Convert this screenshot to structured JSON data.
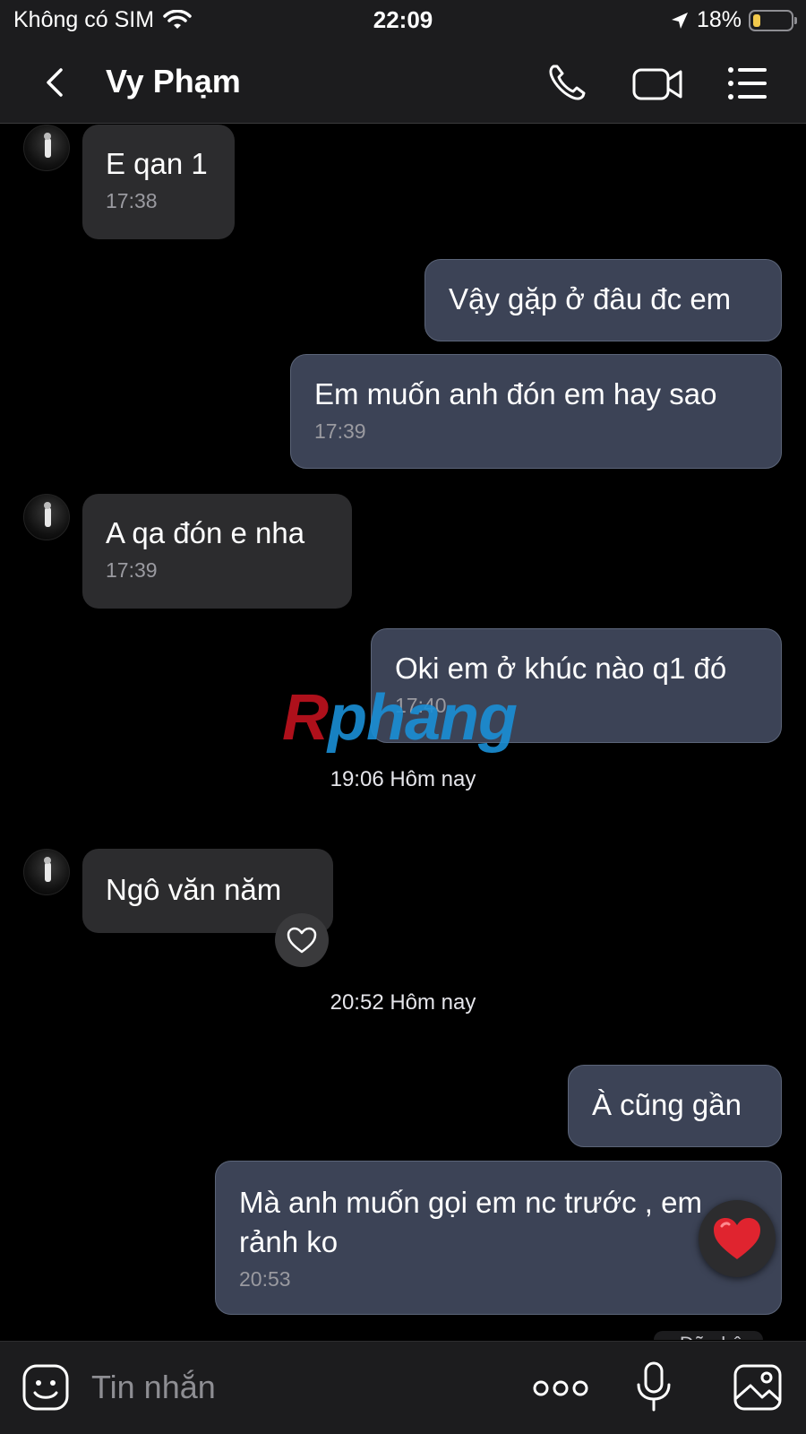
{
  "status_bar": {
    "carrier": "Không có SIM",
    "time": "22:09",
    "battery_percent": "18%",
    "battery_level": 0.18,
    "battery_color": "#f2c94c"
  },
  "header": {
    "contact_name": "Vy Phạm",
    "icons": [
      "back-icon",
      "phone-icon",
      "video-camera-icon",
      "menu-list-icon"
    ]
  },
  "messages": [
    {
      "side": "in",
      "text": "E qan 1",
      "time": "17:38"
    },
    {
      "side": "out",
      "text": "Vậy gặp ở đâu đc em"
    },
    {
      "side": "out",
      "text": "Em muốn anh đón em hay sao",
      "time": "17:39"
    },
    {
      "side": "in",
      "text": "A qa đón e nha",
      "time": "17:39"
    },
    {
      "side": "out",
      "text": "Oki em ở khúc nào q1 đó",
      "time": "17:40"
    },
    {
      "side": "in",
      "text": "Ngô văn năm"
    },
    {
      "side": "out",
      "text": "À cũng gần"
    },
    {
      "side": "out",
      "text": "Mà anh muốn gọi em nc trước , em rảnh ko",
      "time": "20:53"
    }
  ],
  "dividers": [
    "19:06 Hôm nay",
    "20:52 Hôm nay"
  ],
  "seen_label": "Đã nhận",
  "watermark": {
    "first": "R",
    "rest": "phang"
  },
  "composer": {
    "placeholder": "Tin nhắn",
    "icons": [
      "emoji-sticker-icon",
      "more-dots-icon",
      "microphone-icon",
      "image-icon"
    ]
  },
  "colors": {
    "outgoing_bubble": "#3c4356",
    "incoming_bubble": "#2c2c2e",
    "heart": "#e0242f"
  }
}
